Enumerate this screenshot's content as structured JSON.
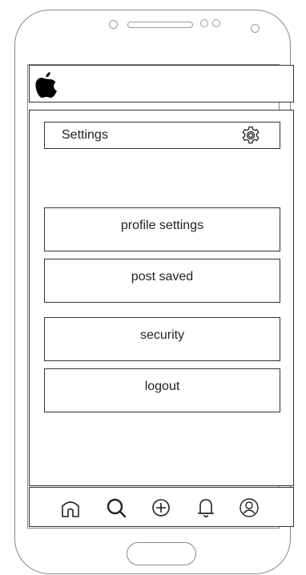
{
  "header": {
    "title": "Settings",
    "icon": "gear-icon"
  },
  "topbar": {
    "logo": "apple-logo"
  },
  "menu": {
    "items": [
      {
        "label": "profile settings"
      },
      {
        "label": "post saved"
      },
      {
        "label": "security"
      },
      {
        "label": "logout"
      }
    ]
  },
  "navbar": {
    "icons": [
      "home-icon",
      "search-icon",
      "add-icon",
      "notification-icon",
      "profile-icon"
    ]
  },
  "colors": {
    "outline": "#333333",
    "frame": "#888888",
    "background": "#ffffff"
  }
}
